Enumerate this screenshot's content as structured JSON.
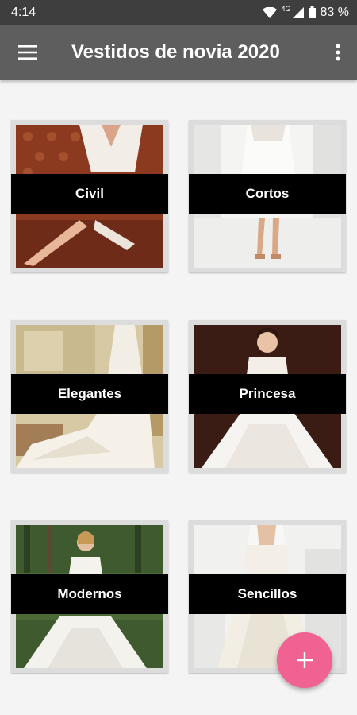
{
  "status_bar": {
    "time": "4:14",
    "network": "4G",
    "battery": "83 %"
  },
  "app_bar": {
    "title": "Vestidos de novia 2020",
    "menu_icon": "hamburger-menu-icon",
    "more_icon": "more-vert-icon"
  },
  "categories": [
    {
      "label": "Civil"
    },
    {
      "label": "Cortos"
    },
    {
      "label": "Elegantes"
    },
    {
      "label": "Princesa"
    },
    {
      "label": "Modernos"
    },
    {
      "label": "Sencillos"
    }
  ],
  "fab": {
    "icon": "plus-icon",
    "color": "#f06292"
  },
  "colors": {
    "status_bar": "#3e3e3e",
    "app_bar": "#5e5e5e",
    "background": "#f4f4f4"
  }
}
